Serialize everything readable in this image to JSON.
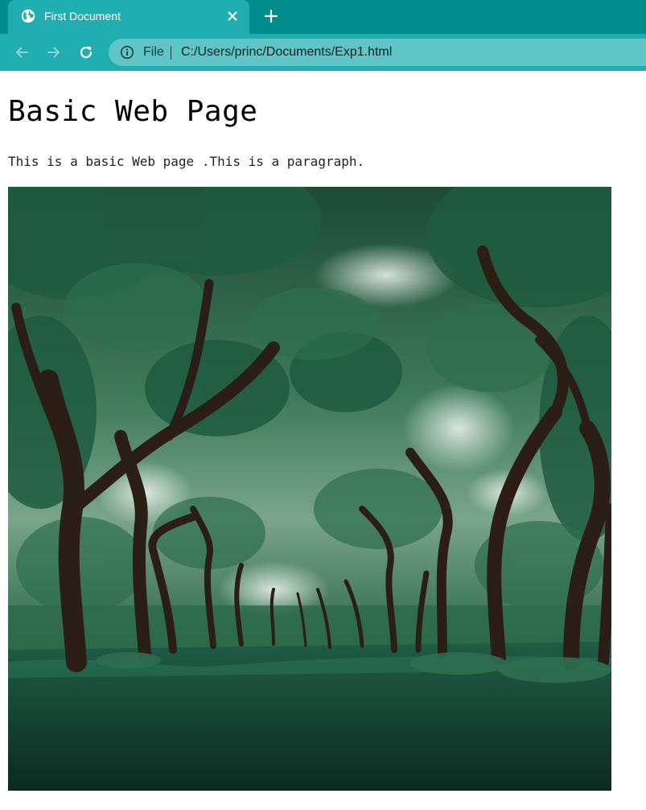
{
  "browser": {
    "tab": {
      "title": "First Document",
      "favicon": "globe-icon"
    },
    "new_tab_icon": "plus-icon",
    "nav": {
      "back_icon": "back-arrow-icon",
      "forward_icon": "forward-arrow-icon",
      "reload_icon": "reload-icon"
    },
    "address": {
      "scheme_label": "File",
      "url": "C:/Users/princ/Documents/Exp1.html",
      "info_icon": "info-icon"
    },
    "colors": {
      "tabstrip": "#008b8c",
      "active_tab": "#20aeb0",
      "omnibox": "#60c5c6"
    }
  },
  "page": {
    "heading": "Basic Web Page",
    "paragraph": "This is a basic Web page .This is a paragraph.",
    "image": {
      "subject": "tree-lined park path photo"
    }
  }
}
